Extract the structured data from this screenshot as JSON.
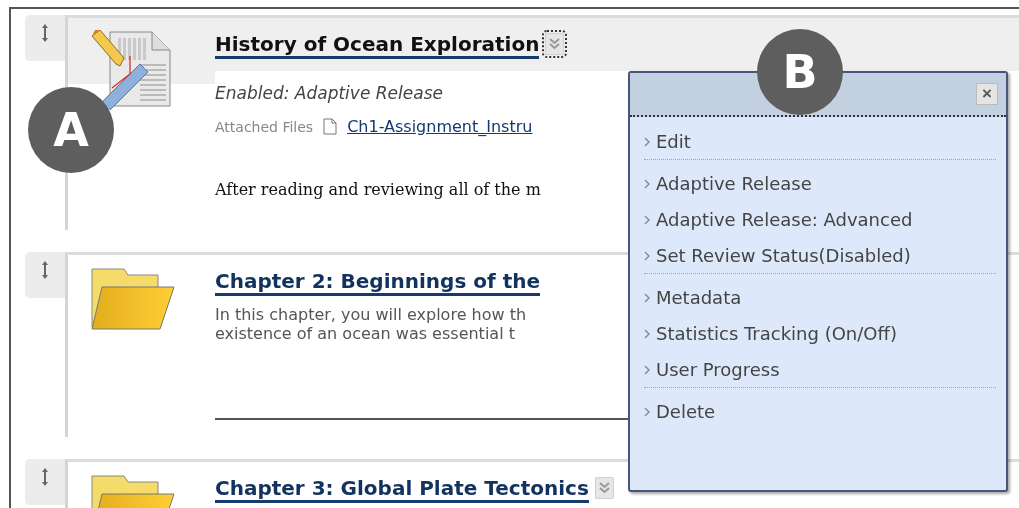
{
  "items": [
    {
      "kind": "assignment",
      "menu_open": true,
      "callout": "A",
      "title": "History of Ocean Exploration",
      "status": "Enabled: Adaptive Release",
      "attached_label": "Attached Files",
      "attached_file": "Ch1-Assignment_Instru",
      "body": "After reading and reviewing all of the m"
    },
    {
      "kind": "folder",
      "menu_open": false,
      "title": "Chapter 2: Beginnings of the",
      "description": [
        "In this chapter, you will explore how th",
        "existence of an ocean was essential t"
      ]
    },
    {
      "kind": "folder",
      "menu_open": false,
      "title": "Chapter 3: Global Plate Tectonics"
    }
  ],
  "menu": {
    "callout": "B",
    "close": "×",
    "items": [
      {
        "label": "Edit",
        "separator_after": true
      },
      {
        "label": "Adaptive Release",
        "separator_after": false
      },
      {
        "label": "Adaptive Release: Advanced",
        "separator_after": false
      },
      {
        "label": "Set Review Status(Disabled)",
        "separator_after": true
      },
      {
        "label": "Metadata",
        "separator_after": false
      },
      {
        "label": "Statistics Tracking (On/Off)",
        "separator_after": false
      },
      {
        "label": "User Progress",
        "separator_after": true
      },
      {
        "label": "Delete",
        "separator_after": false
      }
    ]
  }
}
